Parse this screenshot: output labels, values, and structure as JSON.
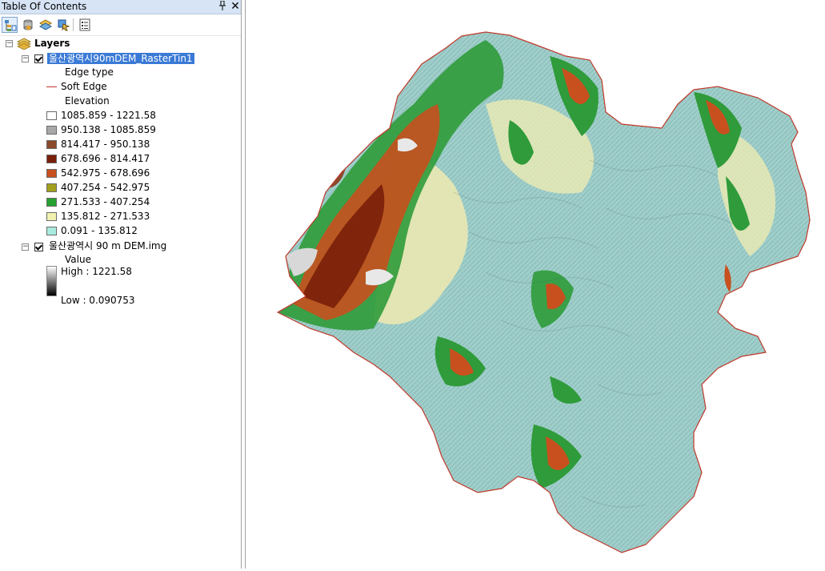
{
  "window": {
    "title": "Table Of Contents",
    "pin_glyph": "⬇",
    "close_glyph": "✕"
  },
  "toolbar": {
    "buttons": [
      {
        "name": "list-by-drawing-order",
        "icon": "list-by-drawing-order-icon",
        "selected": true
      },
      {
        "name": "list-by-source",
        "icon": "list-by-source-icon",
        "selected": false
      },
      {
        "name": "list-by-visibility",
        "icon": "list-by-visibility-icon",
        "selected": false
      },
      {
        "name": "list-by-selection",
        "icon": "list-by-selection-icon",
        "selected": false
      },
      {
        "name": "options",
        "icon": "options-icon",
        "selected": false
      }
    ]
  },
  "toc": {
    "root_label": "Layers",
    "tin_layer": {
      "name": "울산광역시90mDEM_RasterTin1",
      "checked": true,
      "edge_heading": "Edge type",
      "edge_label": "Soft Edge",
      "edge_color": "#c0392b",
      "elevation_heading": "Elevation",
      "classes": [
        {
          "label": "1085.859 - 1221.58",
          "color": "#ffffff"
        },
        {
          "label": "950.138 - 1085.859",
          "color": "#a8a8a8"
        },
        {
          "label": "814.417 - 950.138",
          "color": "#8b4a2b"
        },
        {
          "label": "678.696 - 814.417",
          "color": "#7a1f0a"
        },
        {
          "label": "542.975 - 678.696",
          "color": "#c8501e"
        },
        {
          "label": "407.254 - 542.975",
          "color": "#a3a01e"
        },
        {
          "label": "271.533 - 407.254",
          "color": "#26a12f"
        },
        {
          "label": "135.812 - 271.533",
          "color": "#f2f2b0"
        },
        {
          "label": "0.091 - 135.812",
          "color": "#a9ecdf"
        }
      ]
    },
    "dem_layer": {
      "name": "울산광역시 90 m DEM.img",
      "checked": true,
      "value_heading": "Value",
      "high_label": "High : 1221.58",
      "low_label": "Low : 0.090753"
    }
  },
  "map": {
    "boundary_color": "#c0392b",
    "fill_color": "#9fcfcb"
  }
}
